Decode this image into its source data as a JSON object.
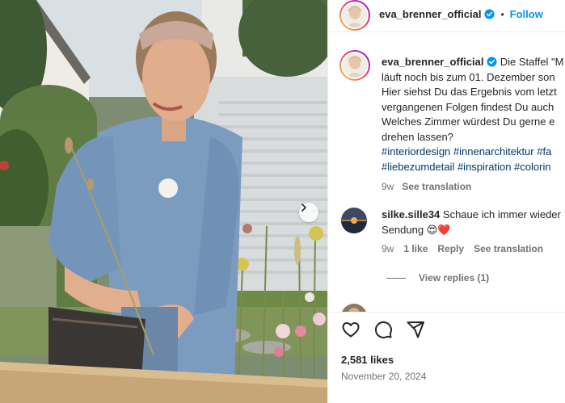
{
  "post": {
    "username": "eva_brenner_official",
    "follow_label": "Follow",
    "dot": "•"
  },
  "caption": {
    "username": "eva_brenner_official",
    "lines": [
      "Die Staffel \"M",
      "läuft noch bis zum 01. Dezember son",
      "Hier siehst Du das Ergebnis vom letzt",
      "vergangenen Folgen findest Du auch",
      "Welches Zimmer würdest Du gerne e",
      "drehen lassen?"
    ],
    "hashtags_line1": "#interiordesign #innenarchitektur #fa",
    "hashtags_line2": "#liebezumdetail #inspiration #colorin",
    "time": "9w",
    "see_translation": "See translation"
  },
  "comment1": {
    "username": "silke.sille34",
    "text_line1": "Schaue ich immer wieder",
    "text_line2": "Sendung",
    "emojis": "😍❤️",
    "time": "9w",
    "likes": "1 like",
    "reply": "Reply",
    "see_translation": "See translation",
    "view_replies": "View replies (1)"
  },
  "actions": {
    "likes": "2,581 likes",
    "date": "November 20, 2024"
  },
  "icons": [
    "verified-badge-icon",
    "chevron-right-icon",
    "heart-icon",
    "comment-icon",
    "share-icon"
  ],
  "colors": {
    "link_blue": "#0095f6",
    "hashtag_blue": "#00376b",
    "secondary_text": "#737373",
    "border": "#efefef"
  }
}
